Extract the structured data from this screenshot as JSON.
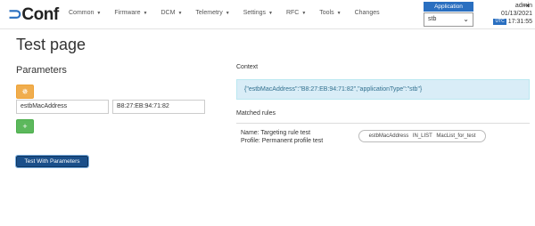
{
  "logo": {
    "bracket": "⊃",
    "text": "Conf"
  },
  "nav": [
    {
      "label": "Common",
      "caret": "▼"
    },
    {
      "label": "Firmware",
      "caret": "▼"
    },
    {
      "label": "DCM",
      "caret": "▼"
    },
    {
      "label": "Telemetry",
      "caret": "▼"
    },
    {
      "label": "Settings",
      "caret": "▼"
    },
    {
      "label": "RFC",
      "caret": "▼"
    },
    {
      "label": "Tools",
      "caret": "▼"
    },
    {
      "label": "Changes",
      "caret": ""
    }
  ],
  "application": {
    "label": "Application",
    "selected": "stb",
    "chevron": "⌄"
  },
  "user": {
    "name": "admin",
    "date": "01/13/2021",
    "utc_badge": "UTC",
    "time": "17:31:55",
    "logout_icon": "⇥"
  },
  "page": {
    "title": "Test page"
  },
  "parameters": {
    "title": "Parameters",
    "add_icon": "✵",
    "key_value": "estbMacAddress",
    "value_value": "B8:27:EB:94:71:82",
    "plus_label": "+",
    "test_button": "Test With Parameters"
  },
  "context": {
    "title": "Context",
    "json": "{\"estbMacAddress\":\"B8:27:EB:94:71:82\",\"applicationType\":\"stb\"}"
  },
  "matched": {
    "title": "Matched rules",
    "name": "Name: Targeting rule test",
    "profile": "Profile: Permanent profile test",
    "condition": {
      "key": "estbMacAddress",
      "operation": "IN_LIST",
      "value": "MacList_for_test"
    }
  },
  "colors": {
    "primary": "#2a6fc0",
    "warning": "#f0ad4e",
    "success": "#5cb85c",
    "info_bg": "#d9edf7",
    "test_button": "#1a4f8a"
  }
}
